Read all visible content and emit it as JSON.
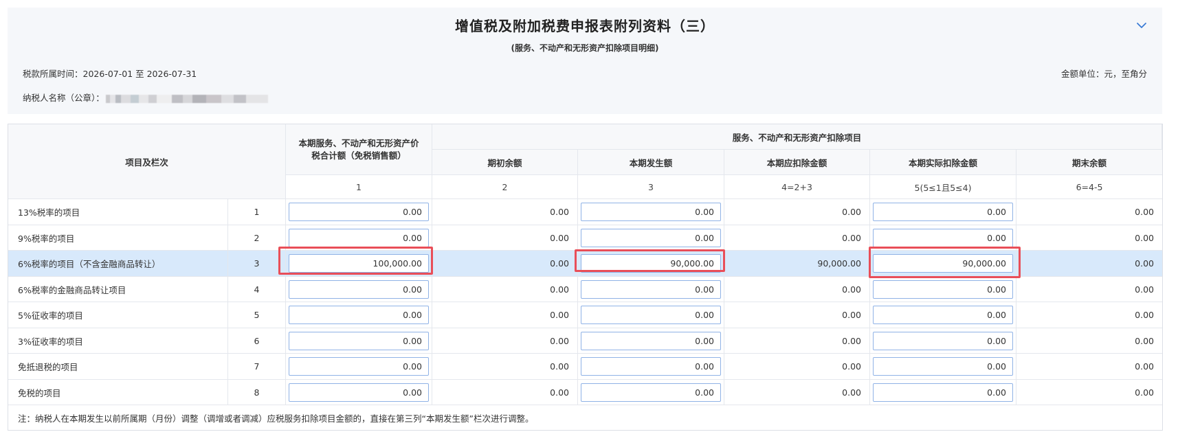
{
  "header": {
    "title": "增值税及附加税费申报表附列资料（三）",
    "subtitle": "(服务、不动产和无形资产扣除项目明细)",
    "period_label": "税款所属时间：",
    "period_value": "2026-07-01 至 2026-07-31",
    "unit_label": "金额单位：元，至角分",
    "taxpayer_label": "纳税人名称（公章）："
  },
  "table": {
    "col_item_header": "项目及栏次",
    "col1_header": "本期服务、不动产和无形资产价税合计额（免税销售额）",
    "group_header": "服务、不动产和无形资产扣除项目",
    "col2_header": "期初余额",
    "col3_header": "本期发生额",
    "col4_header": "本期应扣除金额",
    "col5_header": "本期实际扣除金额",
    "col6_header": "期末余额",
    "col_codes": [
      "1",
      "2",
      "3",
      "4=2+3",
      "5(5≤1且5≤4)",
      "6=4-5"
    ],
    "rows": [
      {
        "label": "13%税率的项目",
        "code": "1",
        "c1": "0.00",
        "c2": "0.00",
        "c3": "0.00",
        "c4": "0.00",
        "c5": "0.00",
        "c6": "0.00"
      },
      {
        "label": "9%税率的项目",
        "code": "2",
        "c1": "0.00",
        "c2": "0.00",
        "c3": "0.00",
        "c4": "0.00",
        "c5": "0.00",
        "c6": "0.00"
      },
      {
        "label": "6%税率的项目（不含金融商品转让）",
        "code": "3",
        "c1": "100,000.00",
        "c2": "0.00",
        "c3": "90,000.00",
        "c4": "90,000.00",
        "c5": "90,000.00",
        "c6": "0.00"
      },
      {
        "label": "6%税率的金融商品转让项目",
        "code": "4",
        "c1": "0.00",
        "c2": "0.00",
        "c3": "0.00",
        "c4": "0.00",
        "c5": "0.00",
        "c6": "0.00"
      },
      {
        "label": "5%征收率的项目",
        "code": "5",
        "c1": "0.00",
        "c2": "0.00",
        "c3": "0.00",
        "c4": "0.00",
        "c5": "0.00",
        "c6": "0.00"
      },
      {
        "label": "3%征收率的项目",
        "code": "6",
        "c1": "0.00",
        "c2": "0.00",
        "c3": "0.00",
        "c4": "0.00",
        "c5": "0.00",
        "c6": "0.00"
      },
      {
        "label": "免抵退税的项目",
        "code": "7",
        "c1": "0.00",
        "c2": "0.00",
        "c3": "0.00",
        "c4": "0.00",
        "c5": "0.00",
        "c6": "0.00"
      },
      {
        "label": "免税的项目",
        "code": "8",
        "c1": "0.00",
        "c2": "0.00",
        "c3": "0.00",
        "c4": "0.00",
        "c5": "0.00",
        "c6": "0.00"
      }
    ],
    "note": "注：纳税人在本期发生以前所属期（月份）调整（调增或者调减）应税服务扣除项目金额的，直接在第三列“本期发生额”栏次进行调整。"
  },
  "colors": {
    "accent": "#3a7bd5",
    "highlight_row": "#d8e9fb",
    "annotation_red": "#e94e58"
  },
  "icons": {
    "collapse": "chevron-down-icon"
  }
}
